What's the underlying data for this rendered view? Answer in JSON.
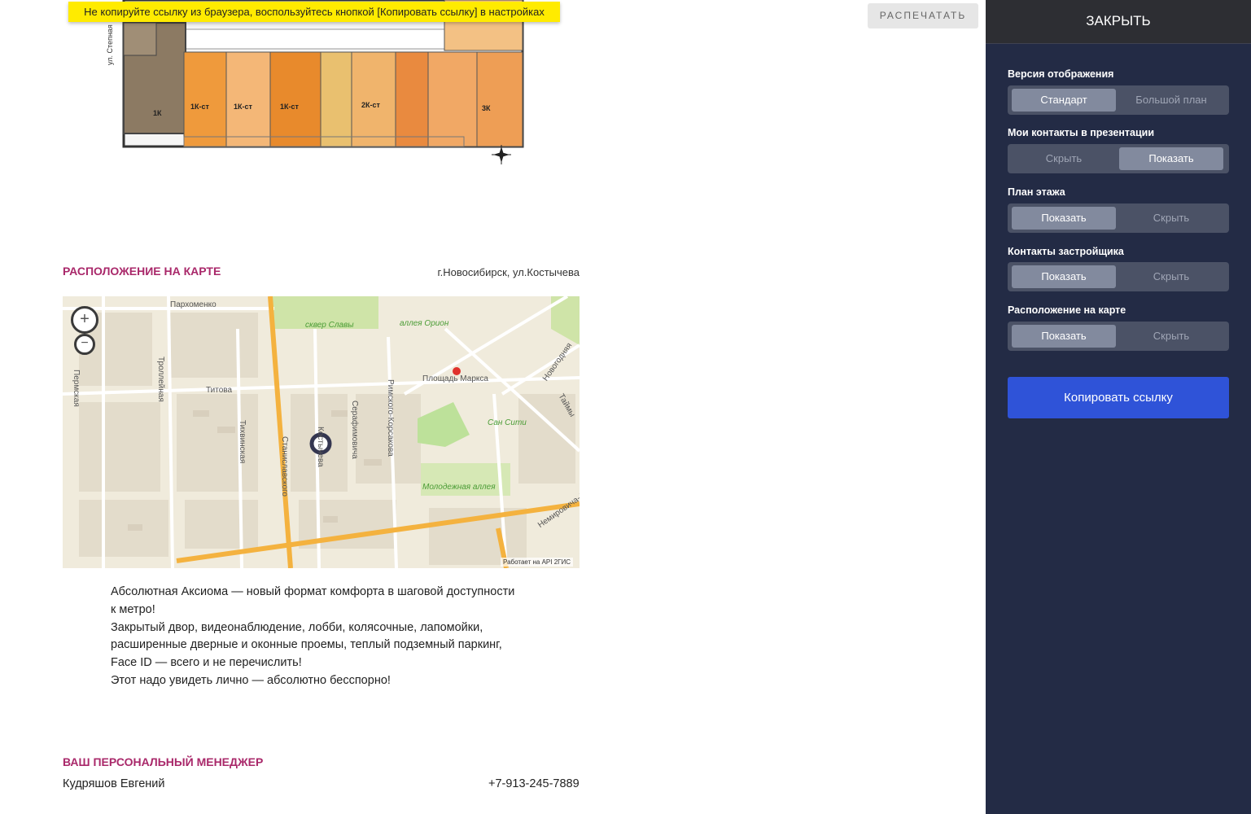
{
  "warning": {
    "text": "Не копируйте ссылку из браузера, воспользуйтесь кнопкой [Копировать ссылку] в настройках"
  },
  "print_button": {
    "label": "РАСПЕЧАТАТЬ"
  },
  "floorplan": {
    "street_label": "ул. Степная",
    "units": [
      "1К",
      "1К-ст",
      "1К-ст",
      "1К-ст",
      "2К-ст",
      "3К"
    ]
  },
  "map_section": {
    "title": "РАСПОЛОЖЕНИЕ НА КАРТЕ",
    "address": "г.Новосибирск, ул.Костычева",
    "zoom_in": "+",
    "zoom_out": "−",
    "credit": "Работает на API 2ГИС",
    "labels": {
      "parkhomenko": "Пархоменко",
      "skver": "сквер Славы",
      "alleya_orion": "аллея Орион",
      "permskaya": "Пермская",
      "troleynaya": "Троллейная",
      "titova": "Титова",
      "ploshchad": "Площадь Маркса",
      "novogodnyaya": "Новогодняя",
      "tikhvinskaya": "Тихвинская",
      "stanislavskogo": "Станиславского",
      "serafimovicha": "Серафимовича",
      "rimskogo": "Римского-Корсакова",
      "kostycheva": "Костычева",
      "san_siti": "Сан Сити",
      "molodezhnaya": "Молодежная аллея",
      "nemirovicha": "Немировича-Д",
      "taymyrskaya": "Таймы"
    }
  },
  "description": {
    "lines": [
      "Абсолютная Аксиома — новый формат комфорта в шаговой доступности",
      "к метро!",
      "Закрытый двор, видеонаблюдение, лобби, колясочные, лапомойки,",
      "расширенные дверные и оконные проемы, теплый подземный паркинг,",
      "Face ID — всего и не перечислить!",
      "Этот надо увидеть лично — абсолютно бесспорно!"
    ]
  },
  "manager": {
    "title": "ВАШ ПЕРСОНАЛЬНЫЙ МЕНЕДЖЕР",
    "name": "Кудряшов Евгений",
    "phone": "+7-913-245-7889"
  },
  "panel": {
    "close_label": "ЗАКРЫТЬ",
    "options": [
      {
        "label": "Версия отображения",
        "left": "Стандарт",
        "right": "Большой план",
        "active": "left"
      },
      {
        "label": "Мои контакты в презентации",
        "left": "Скрыть",
        "right": "Показать",
        "active": "right"
      },
      {
        "label": "План этажа",
        "left": "Показать",
        "right": "Скрыть",
        "active": "left"
      },
      {
        "label": "Контакты застройщика",
        "left": "Показать",
        "right": "Скрыть",
        "active": "left"
      },
      {
        "label": "Расположение на карте",
        "left": "Показать",
        "right": "Скрыть",
        "active": "left"
      }
    ],
    "copy_button": "Копировать ссылку"
  },
  "colors": {
    "panel_bg": "#232b45",
    "accent_magenta": "#a9286a",
    "copy_button": "#2f53d8",
    "warning_bg": "#ffeb00"
  }
}
